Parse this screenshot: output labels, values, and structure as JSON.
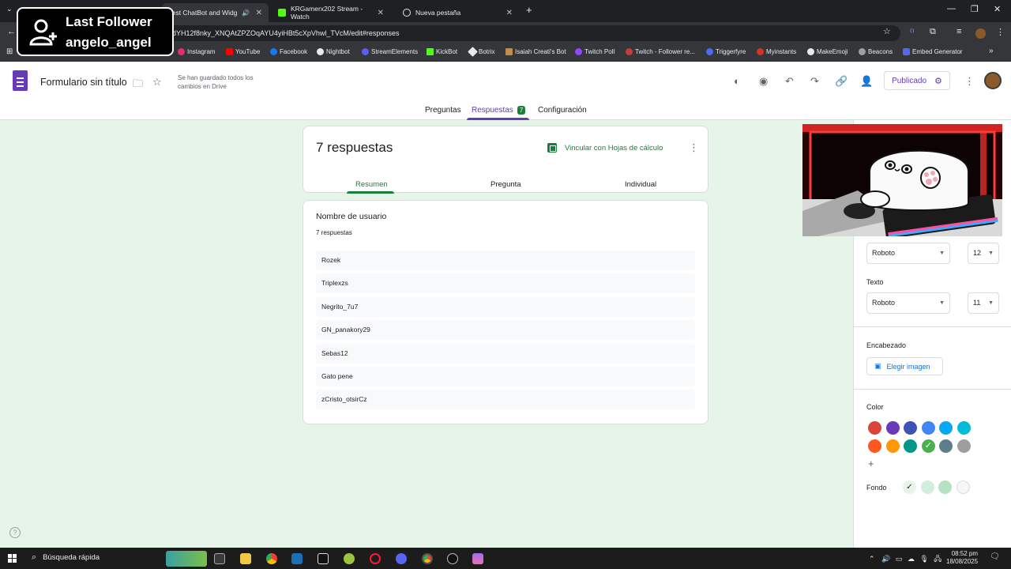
{
  "browser": {
    "tabs": [
      {
        "title": "best ChatBot and Widg",
        "active": true
      },
      {
        "title": "KRGamerx202 Stream - Watch",
        "active": false
      },
      {
        "title": "Nueva pestaña",
        "active": false
      }
    ],
    "url": "dYH12f8nky_XNQAtZPZOqAYU4yiHBt5cXpVhwl_TVcM/edit#responses",
    "bookmarks": [
      "Instagram",
      "YouTube",
      "Facebook",
      "Nightbot",
      "StreamElements",
      "KickBot",
      "Botrix",
      "Isaiah Creati's Bot",
      "Twitch Poll",
      "Twitch - Follower re...",
      "Triggerfyre",
      "Myinstants",
      "MakeEmoji",
      "Beacons",
      "Embed Generator"
    ]
  },
  "overlay": {
    "line1": "Last Follower",
    "line2": "angelo_angel"
  },
  "forms": {
    "title": "Formulario sin título",
    "saved_status": "Se han guardado todos los cambios en Drive",
    "publish_label": "Publicado",
    "tabs": {
      "preguntas": "Preguntas",
      "respuestas": "Respuestas",
      "respuestas_count": "7",
      "configuracion": "Configuración"
    }
  },
  "summary": {
    "count_label": "7 respuestas",
    "link_sheets": "Vincular con Hojas de cálculo",
    "subtabs": {
      "resumen": "Resumen",
      "pregunta": "Pregunta",
      "individual": "Individual"
    }
  },
  "question": {
    "title": "Nombre de usuario",
    "count": "7 respuestas",
    "answers": [
      "Rozek",
      "Triplexzs",
      "Negrito_7u7",
      "GN_panakory29",
      "Sebas12",
      "Gato pene",
      "zCristo_otsirCz"
    ]
  },
  "theme": {
    "header_font": "Roboto",
    "header_size": "12",
    "text_label": "Texto",
    "text_font": "Roboto",
    "text_size": "11",
    "header_label": "Encabezado",
    "choose_image": "Elegir imagen",
    "color_label": "Color",
    "background_label": "Fondo",
    "colors": [
      "#db4437",
      "#673ab7",
      "#3f51b5",
      "#4285f4",
      "#03a9f4",
      "#00bcd4",
      "#ff5722",
      "#ff9800",
      "#009688",
      "#4caf50",
      "#607d8b",
      "#9e9e9e"
    ],
    "selected_color": "#4caf50",
    "backgrounds": [
      "#e6f4ea",
      "#d2eed9",
      "#b7e1c3",
      "#f6f6f6"
    ]
  },
  "taskbar": {
    "search": "Búsqueda rápida",
    "time": "08:52 pm",
    "date": "18/08/2025"
  }
}
